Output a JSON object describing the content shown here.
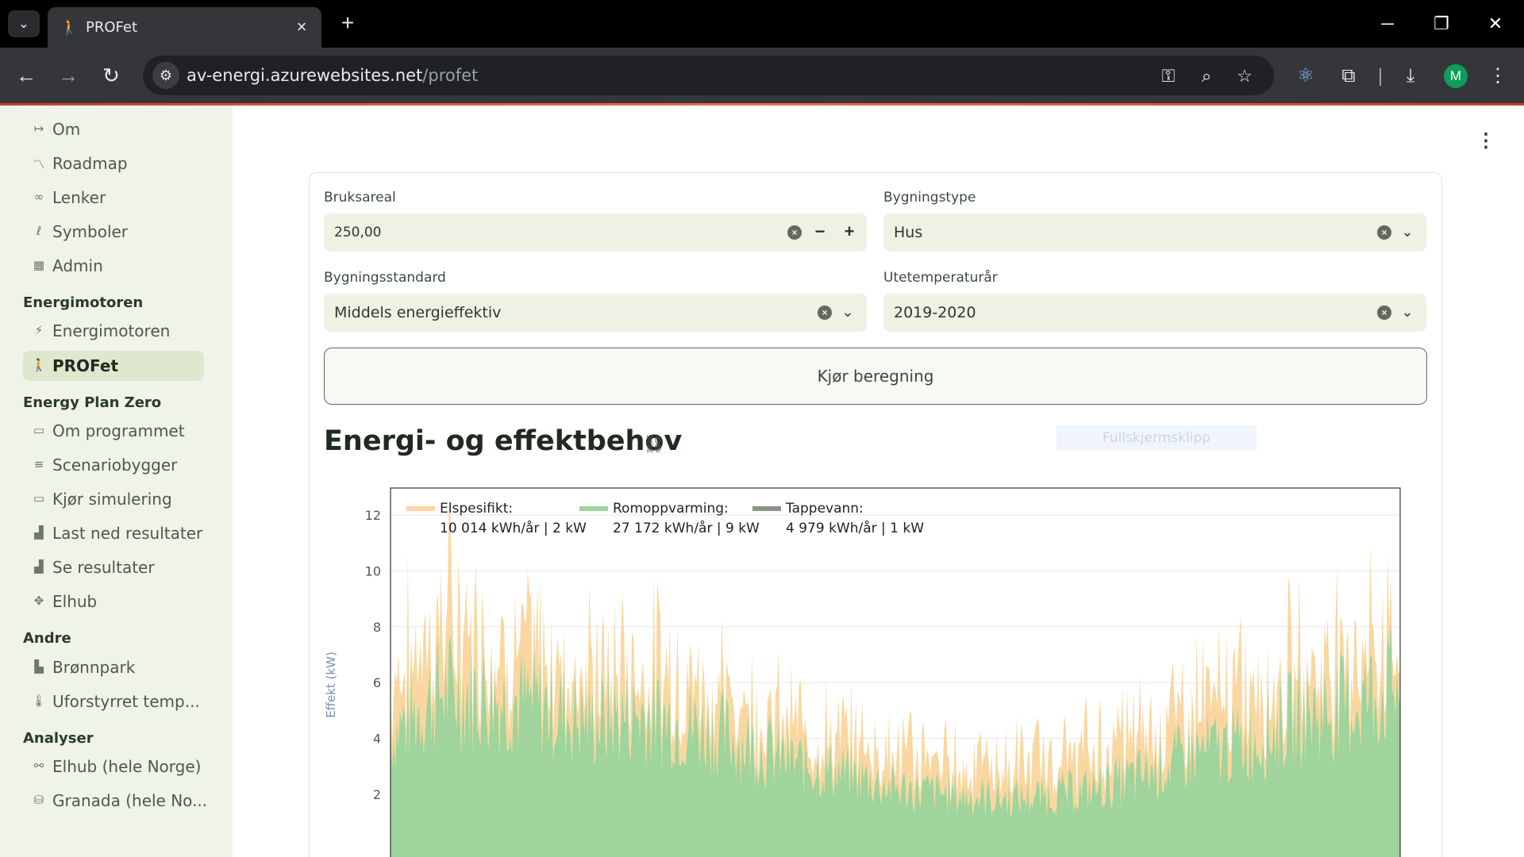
{
  "browser": {
    "tab_title": "PROFet",
    "url_host": "av-energi.azurewebsites.net",
    "url_path": "/profet",
    "profile_initial": "M"
  },
  "sidebar": {
    "items_top": [
      {
        "label": "Om",
        "icon": "arrow-right-icon"
      },
      {
        "label": "Roadmap",
        "icon": "chart-line-icon"
      },
      {
        "label": "Lenker",
        "icon": "link-icon"
      },
      {
        "label": "Symboler",
        "icon": "symbol-icon"
      },
      {
        "label": "Admin",
        "icon": "admin-icon"
      }
    ],
    "sections": [
      {
        "heading": "Energimotoren",
        "items": [
          {
            "label": "Energimotoren",
            "icon": "engine-icon"
          },
          {
            "label": "PROFet",
            "icon": "person-walking-icon",
            "active": true
          }
        ]
      },
      {
        "heading": "Energy Plan Zero",
        "items": [
          {
            "label": "Om programmet",
            "icon": "window-icon"
          },
          {
            "label": "Scenariobygger",
            "icon": "builder-icon"
          },
          {
            "label": "Kjør simulering",
            "icon": "laptop-icon"
          },
          {
            "label": "Last ned resultater",
            "icon": "chart-area-icon"
          },
          {
            "label": "Se resultater",
            "icon": "chart-area-icon"
          },
          {
            "label": "Elhub",
            "icon": "hub-icon"
          }
        ]
      },
      {
        "heading": "Andre",
        "items": [
          {
            "label": "Brønnpark",
            "icon": "factory-icon"
          },
          {
            "label": "Uforstyrret temp...",
            "icon": "thermometer-icon"
          }
        ]
      },
      {
        "heading": "Analyser",
        "items": [
          {
            "label": "Elhub (hele Norge)",
            "icon": "analysis-icon"
          },
          {
            "label": "Granada (hele No...",
            "icon": "database-icon"
          }
        ]
      }
    ]
  },
  "form": {
    "bruksareal": {
      "label": "Bruksareal",
      "value": "250,00"
    },
    "bygningstype": {
      "label": "Bygningstype",
      "value": "Hus"
    },
    "bygningsstandard": {
      "label": "Bygningsstandard",
      "value": "Middels energieffektiv"
    },
    "utetemperaturar": {
      "label": "Utetemperaturår",
      "value": "2019-2020"
    },
    "run_button": "Kjør beregning"
  },
  "section_title": "Energi- og effektbehov",
  "snip_overlay": "Fullskjermsklipp",
  "chart_data": {
    "type": "area",
    "ylabel": "Effekt (kW)",
    "xlabel": "",
    "ylim": [
      0,
      13
    ],
    "yticks": [
      2,
      4,
      6,
      8,
      10,
      12
    ],
    "grid": true,
    "legend_position": "top-left",
    "series": [
      {
        "name": "Elspesifikt:",
        "summary": "10 014 kWh/år | 2 kW",
        "color": "#fad7a0"
      },
      {
        "name": "Romoppvarming:",
        "summary": "27 172 kWh/år | 9 kW",
        "color": "#9fd49c"
      },
      {
        "name": "Tappevann:",
        "summary": "4 979 kWh/år | 1 kW",
        "color": "#8a958a"
      }
    ],
    "profile_points": {
      "relative_time": [
        0,
        0.05,
        0.1,
        0.15,
        0.2,
        0.25,
        0.3,
        0.35,
        0.4,
        0.45,
        0.5,
        0.55,
        0.6,
        0.65,
        0.7,
        0.75,
        0.8,
        0.85,
        0.9,
        0.95,
        1.0
      ],
      "romoppvarming_kw": [
        4.5,
        6.2,
        6.0,
        5.6,
        5.0,
        5.3,
        4.8,
        4.2,
        3.4,
        3.0,
        2.4,
        2.2,
        2.0,
        2.1,
        2.4,
        3.0,
        3.8,
        4.2,
        5.2,
        5.6,
        6.5
      ],
      "elspesifikt_peak_kw": [
        8.0,
        11.0,
        9.5,
        9.0,
        8.2,
        8.6,
        8.0,
        6.8,
        5.8,
        5.2,
        4.8,
        4.4,
        4.2,
        4.4,
        5.0,
        6.0,
        7.2,
        7.8,
        8.5,
        9.5,
        9.8
      ]
    }
  }
}
